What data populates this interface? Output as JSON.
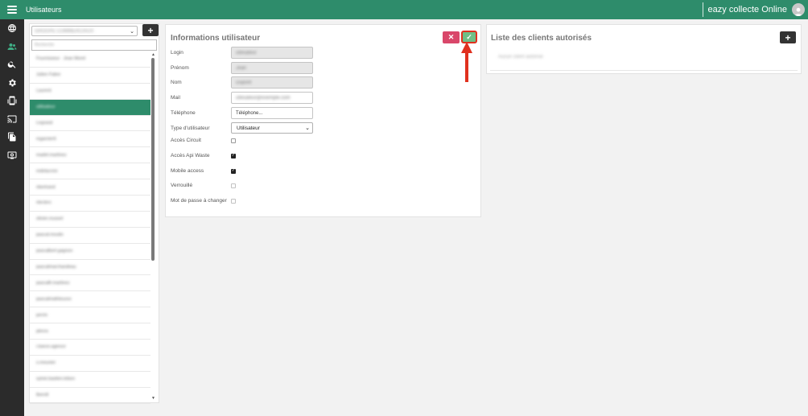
{
  "topbar": {
    "title": "Utilisateurs",
    "brand": "eazy collecte Online"
  },
  "sidebar": {
    "items": [
      {
        "icon": "globe-icon",
        "active": false
      },
      {
        "icon": "users-icon",
        "active": true
      },
      {
        "icon": "search-icon",
        "active": false
      },
      {
        "icon": "gear-icon",
        "active": false
      },
      {
        "icon": "mobile-icon",
        "active": false
      },
      {
        "icon": "cast-icon",
        "active": false
      },
      {
        "icon": "documents-icon",
        "active": false
      },
      {
        "icon": "display-icon",
        "active": false
      }
    ]
  },
  "user_list": {
    "filter_value": "GROUPE COMMERCIAUX",
    "search_value": "Recherche",
    "add_label": "+",
    "items": [
      {
        "label": "Fournisseur · Jean Morel",
        "selected": false
      },
      {
        "label": "Julien Fabre",
        "selected": false
      },
      {
        "label": "Laurent",
        "selected": false
      },
      {
        "label": "utilisateur",
        "selected": true
      },
      {
        "label": "Legrand",
        "selected": false
      },
      {
        "label": "mgarnier6",
        "selected": false
      },
      {
        "label": "madel.martinez",
        "selected": false
      },
      {
        "label": "mdelacroix",
        "selected": false
      },
      {
        "label": "nbertrand",
        "selected": false
      },
      {
        "label": "nleclerc",
        "selected": false
      },
      {
        "label": "olivier.roussel",
        "selected": false
      },
      {
        "label": "pascal.moulin",
        "selected": false
      },
      {
        "label": "pascalbert.gagnon",
        "selected": false
      },
      {
        "label": "pascalmarchandeau",
        "selected": false
      },
      {
        "label": "pascalfr.martinez",
        "selected": false
      },
      {
        "label": "pascalmathieuxxx",
        "selected": false
      },
      {
        "label": "perrin",
        "selected": false
      },
      {
        "label": "plerox",
        "selected": false
      },
      {
        "label": "r.baron.agence",
        "selected": false
      },
      {
        "label": "s.meunier",
        "selected": false
      },
      {
        "label": "sylvie.bastien.lebon",
        "selected": false
      },
      {
        "label": "tberolt",
        "selected": false
      }
    ]
  },
  "user_info": {
    "title": "Informations utilisateur",
    "cancel_label": "✕",
    "save_label": "✓",
    "fields": {
      "login": {
        "label": "Login",
        "value": "utilisateur"
      },
      "firstname": {
        "label": "Prénom",
        "value": "Jean"
      },
      "lastname": {
        "label": "Nom",
        "value": "Dupont"
      },
      "mail": {
        "label": "Mail",
        "value": "utilisateur@exemple.com"
      },
      "phone": {
        "label": "Téléphone",
        "value": "Téléphone..."
      },
      "user_type": {
        "label": "Type d'utilisateur",
        "value": "Utilisateur"
      }
    },
    "checks": [
      {
        "label": "Accès Circuit",
        "checked": false,
        "disabled": false
      },
      {
        "label": "Accès Api Waste",
        "checked": true,
        "disabled": false
      },
      {
        "label": "Mobile access",
        "checked": true,
        "disabled": false
      },
      {
        "label": "Verrouillé",
        "checked": false,
        "disabled": true
      },
      {
        "label": "Mot de passe à changer",
        "checked": false,
        "disabled": true
      }
    ]
  },
  "clients": {
    "title": "Liste des clients autorisés",
    "add_label": "+",
    "empty_text": "Aucun client autorisé"
  },
  "colors": {
    "topbar": "#2e8c6b",
    "sidebar": "#2b2b2b",
    "selected_row": "#2e8c6b",
    "cancel": "#d9476a",
    "save": "#6fbf86",
    "annotation_arrow": "#e0301e"
  }
}
